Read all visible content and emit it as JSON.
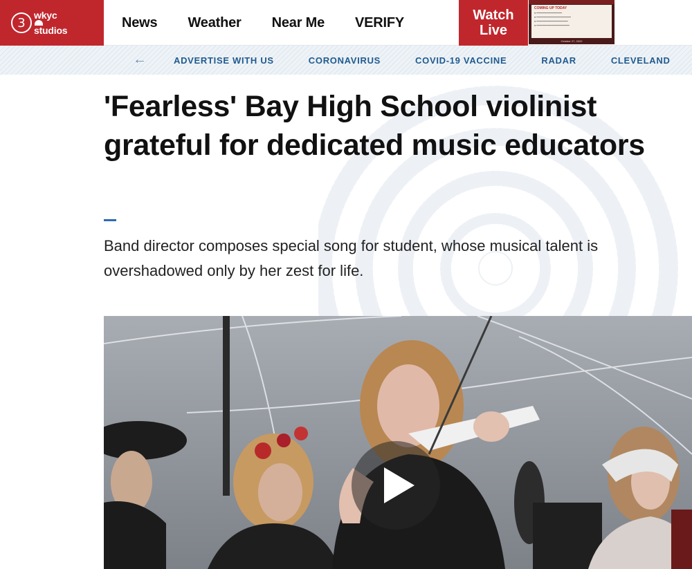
{
  "header": {
    "logo": {
      "number": "3",
      "line1": "wkyc",
      "line2": "studios"
    },
    "nav": [
      {
        "label": "News"
      },
      {
        "label": "Weather"
      },
      {
        "label": "Near Me"
      },
      {
        "label": "VERIFY"
      }
    ],
    "watch_live": {
      "line1": "Watch",
      "line2": "Live"
    },
    "live_thumbnail": {
      "heading": "COMING UP TODAY",
      "date": "October 27, 2022"
    }
  },
  "sub_nav": {
    "items": [
      {
        "label": "ADVERTISE WITH US"
      },
      {
        "label": "CORONAVIRUS"
      },
      {
        "label": "COVID-19 VACCINE"
      },
      {
        "label": "RADAR"
      },
      {
        "label": "CLEVELAND"
      }
    ]
  },
  "article": {
    "headline": "'Fearless' Bay High School violinist grateful for dedicated music educators",
    "dek": "Band director composes special song for student, whose musical talent is overshadowed only by her zest for life."
  },
  "colors": {
    "brand_red": "#c0272d",
    "link_blue": "#1f5a8f",
    "accent_blue": "#2b6cb0"
  }
}
